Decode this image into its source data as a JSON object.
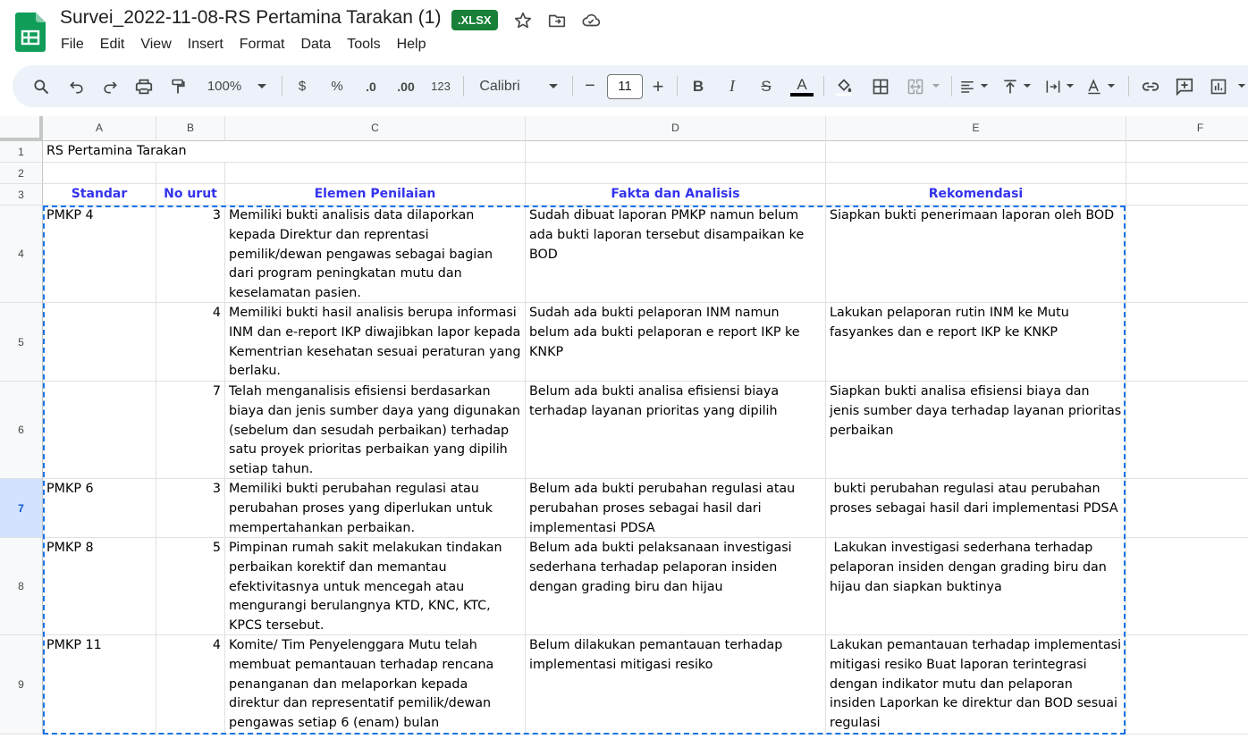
{
  "doc": {
    "title": "Survei_2022-11-08-RS Pertamina Tarakan (1)",
    "badge": ".XLSX"
  },
  "menu": [
    "File",
    "Edit",
    "View",
    "Insert",
    "Format",
    "Data",
    "Tools",
    "Help"
  ],
  "toolbar": {
    "zoom": "100%",
    "currency": "$",
    "percent": "%",
    "dec_decrease": ".0",
    "dec_increase": ".00",
    "number_format": "123",
    "font": "Calibri",
    "font_size": "11",
    "minus": "−",
    "plus": "+",
    "bold": "B",
    "italic": "I",
    "strike": "S",
    "text_color": "A"
  },
  "columns": [
    "A",
    "B",
    "C",
    "D",
    "E",
    "F"
  ],
  "rows": [
    "1",
    "2",
    "3",
    "4",
    "5",
    "6",
    "7",
    "8",
    "9"
  ],
  "selected_row": "7",
  "sheet": {
    "a1": "RS Pertamina Tarakan",
    "headers": [
      "Standar",
      "No urut",
      "Elemen Penilaian",
      "Fakta dan Analisis",
      "Rekomendasi"
    ],
    "records": [
      {
        "standar": "PMKP 4",
        "no": "3",
        "elemen": "Memiliki bukti analisis data dilaporkan kepada  Direktur dan reprentasi pemilik/dewan pengawas sebagai bagian dari program peningkatan mutu dan keselamatan pasien.",
        "fakta": "Sudah dibuat laporan PMKP namun belum ada bukti laporan tersebut disampaikan ke BOD",
        "rekomendasi": "Siapkan bukti penerimaan laporan oleh BOD"
      },
      {
        "standar": "",
        "no": "4",
        "elemen": "Memiliki bukti hasil analisis berupa informasi INM dan e-report IKP diwajibkan lapor kepada Kementrian kesehatan sesuai peraturan yang berlaku.",
        "fakta": "Sudah ada bukti pelaporan INM namun belum ada bukti pelaporan e report IKP ke KNKP",
        "rekomendasi": "Lakukan pelaporan rutin INM ke Mutu fasyankes dan e report IKP ke KNKP"
      },
      {
        "standar": "",
        "no": "7",
        "elemen": "Telah menganalisis efisiensi berdasarkan biaya dan jenis sumber daya yang digunakan (sebelum dan sesudah perbaikan) terhadap satu proyek prioritas perbaikan yang dipilih setiap tahun.",
        "fakta": "Belum ada bukti analisa efisiensi biaya terhadap layanan prioritas yang dipilih",
        "rekomendasi": "Siapkan bukti analisa efisiensi biaya dan jenis sumber daya terhadap layanan prioritas perbaikan"
      },
      {
        "standar": "PMKP 6",
        "no": "3",
        "elemen": "Memiliki bukti perubahan regulasi atau perubahan proses yang diperlukan untuk mempertahankan perbaikan.",
        "fakta": "Belum ada bukti perubahan regulasi atau perubahan proses sebagai hasil dari implementasi PDSA",
        "rekomendasi": " bukti perubahan regulasi atau perubahan proses sebagai hasil dari implementasi PDSA"
      },
      {
        "standar": "PMKP 8",
        "no": "5",
        "elemen": "Pimpinan rumah sakit melakukan tindakan perbaikan korektif dan memantau efektivitasnya untuk mencegah atau mengurangi berulangnya KTD, KNC, KTC, KPCS tersebut.",
        "fakta": "Belum ada bukti pelaksanaan investigasi sederhana terhadap pelaporan insiden dengan grading biru dan hijau",
        "rekomendasi": " Lakukan investigasi sederhana terhadap pelaporan insiden dengan grading biru dan hijau dan siapkan buktinya"
      },
      {
        "standar": "PMKP 11",
        "no": "4",
        "elemen": "Komite/ Tim Penyelenggara Mutu telah membuat pemantauan terhadap rencana penanganan dan melaporkan kepada direktur dan representatif pemilik/dewan pengawas setiap 6 (enam) bulan",
        "fakta": "Belum dilakukan pemantauan terhadap implementasi mitigasi resiko",
        "rekomendasi": "Lakukan pemantauan terhadap implementasi mitigasi resiko  Buat laporan terintegrasi dengan indikator mutu dan pelaporan insiden Laporkan ke direktur dan BOD sesuai regulasi"
      }
    ]
  }
}
